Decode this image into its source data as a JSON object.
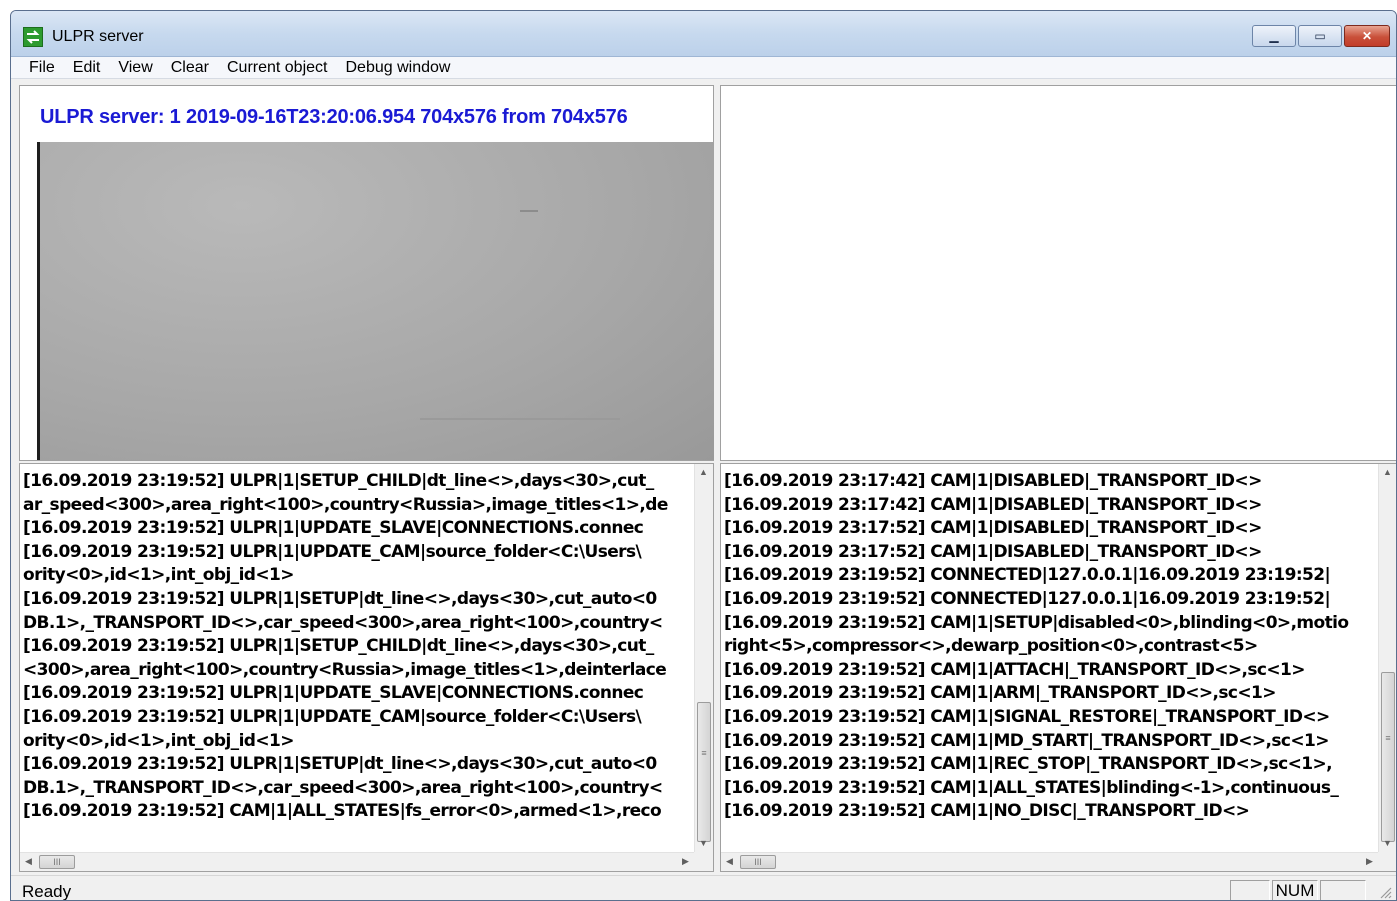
{
  "window": {
    "title": "ULPR server"
  },
  "menu": [
    "File",
    "Edit",
    "View",
    "Clear",
    "Current object",
    "Debug window"
  ],
  "video": {
    "header": "ULPR server: 1 2019-09-16T23:20:06.954 704x576 from 704x576"
  },
  "log_left": [
    "[16.09.2019 23:19:52] ULPR|1|SETUP_CHILD|dt_line<>,days<30>,cut_",
    "ar_speed<300>,area_right<100>,country<Russia>,image_titles<1>,de",
    "[16.09.2019 23:19:52] ULPR|1|UPDATE_SLAVE|CONNECTIONS.connec",
    "[16.09.2019 23:19:52] ULPR|1|UPDATE_CAM|source_folder<C:\\Users\\",
    "ority<0>,id<1>,int_obj_id<1>",
    "[16.09.2019 23:19:52] ULPR|1|SETUP|dt_line<>,days<30>,cut_auto<0",
    "DB.1>,_TRANSPORT_ID<>,car_speed<300>,area_right<100>,country<",
    "[16.09.2019 23:19:52] ULPR|1|SETUP_CHILD|dt_line<>,days<30>,cut_",
    "<300>,area_right<100>,country<Russia>,image_titles<1>,deinterlace",
    "[16.09.2019 23:19:52] ULPR|1|UPDATE_SLAVE|CONNECTIONS.connec",
    "[16.09.2019 23:19:52] ULPR|1|UPDATE_CAM|source_folder<C:\\Users\\",
    "ority<0>,id<1>,int_obj_id<1>",
    "[16.09.2019 23:19:52] ULPR|1|SETUP|dt_line<>,days<30>,cut_auto<0",
    "DB.1>,_TRANSPORT_ID<>,car_speed<300>,area_right<100>,country<",
    "[16.09.2019 23:19:52] CAM|1|ALL_STATES|fs_error<0>,armed<1>,reco"
  ],
  "log_right": [
    "[16.09.2019 23:17:42] CAM|1|DISABLED|_TRANSPORT_ID<>",
    "[16.09.2019 23:17:42] CAM|1|DISABLED|_TRANSPORT_ID<>",
    "[16.09.2019 23:17:52] CAM|1|DISABLED|_TRANSPORT_ID<>",
    "[16.09.2019 23:17:52] CAM|1|DISABLED|_TRANSPORT_ID<>",
    "[16.09.2019 23:19:52] CONNECTED|127.0.0.1|16.09.2019 23:19:52|",
    "[16.09.2019 23:19:52] CONNECTED|127.0.0.1|16.09.2019 23:19:52|",
    "[16.09.2019 23:19:52] CAM|1|SETUP|disabled<0>,blinding<0>,motio",
    "right<5>,compressor<>,dewarp_position<0>,contrast<5>",
    "[16.09.2019 23:19:52] CAM|1|ATTACH|_TRANSPORT_ID<>,sc<1>",
    "[16.09.2019 23:19:52] CAM|1|ARM|_TRANSPORT_ID<>,sc<1>",
    "[16.09.2019 23:19:52] CAM|1|SIGNAL_RESTORE|_TRANSPORT_ID<>",
    "[16.09.2019 23:19:52] CAM|1|MD_START|_TRANSPORT_ID<>,sc<1>",
    "[16.09.2019 23:19:52] CAM|1|REC_STOP|_TRANSPORT_ID<>,sc<1>,",
    "[16.09.2019 23:19:52] CAM|1|ALL_STATES|blinding<-1>,continuous_",
    "[16.09.2019 23:19:52] CAM|1|NO_DISC|_TRANSPORT_ID<>"
  ],
  "status": {
    "text": "Ready",
    "num": "NUM"
  },
  "icons": {
    "app": "ulpr-app-icon",
    "minimize": "minimize-icon",
    "maximize": "maximize-icon",
    "close": "close-icon",
    "grip": "resize-grip-icon"
  },
  "colors": {
    "video_header": "#1a1ad4",
    "close_button": "#c9503a",
    "app_icon": "#2d9b2f"
  }
}
